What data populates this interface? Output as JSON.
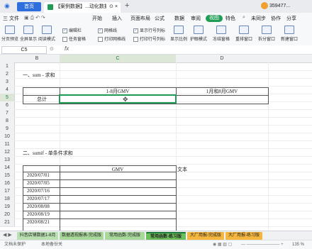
{
  "titlebar": {
    "home_tab": "首页",
    "doc_tab": "【案例数据】...动化数据报表",
    "pin": "⊙",
    "close": "×",
    "new_tab": "+",
    "user": "359477..."
  },
  "menu": {
    "file": "三 文件",
    "items": [
      "开始",
      "插入",
      "页面布局",
      "公式",
      "数据",
      "审阅",
      "视图",
      "特色",
      "未同步",
      "协作",
      "分享"
    ],
    "active": "视图"
  },
  "toolbar": {
    "buttons": [
      "分页预览",
      "全屏显示",
      "阅读模式",
      "显示比例",
      "护眼模式",
      "冻结窗格",
      "重排窗口",
      "拆分窗口",
      "新建窗口"
    ],
    "checkboxes": [
      {
        "label": "编辑栏",
        "checked": true
      },
      {
        "label": "网格线",
        "checked": true
      },
      {
        "label": "显示行号列标",
        "checked": true
      },
      {
        "label": "任务窗格",
        "checked": false
      },
      {
        "label": "打印网格线",
        "checked": false
      },
      {
        "label": "打印行号列标",
        "checked": false
      }
    ]
  },
  "formula": {
    "namebox": "C5",
    "zoom_icon": "⊙",
    "fx": "fx",
    "value": ""
  },
  "grid": {
    "columns": [
      "B",
      "C",
      "D"
    ],
    "selected_column": "C",
    "rows": [
      "1",
      "2",
      "3",
      "4",
      "5",
      "6",
      "7",
      "8",
      "9",
      "10",
      "11",
      "12",
      "13",
      "14",
      "15",
      "16",
      "17",
      "18",
      "19",
      "20",
      "21"
    ],
    "selected_row": "5",
    "section1_title": "一、sum - 求和",
    "header_c4": "1-8月GMV",
    "header_d4": "1月和8月GMV",
    "label_b5": "总计",
    "section2_title": "二、sumif - 单条件求和",
    "gmv_header": "GMV",
    "text_header": "文本",
    "dates": [
      "2020/07/01",
      "2020/07/05",
      "2020/07/16",
      "2020/07/17",
      "2020/08/08",
      "2020/08/19",
      "2020/08/21"
    ]
  },
  "sheets": [
    {
      "label": "抖音店铺数据1-8月",
      "color": "#b8e0b0"
    },
    {
      "label": "数据透视报表-完成版",
      "color": "#a8d89a"
    },
    {
      "label": "常用函数-完成版",
      "color": "#a8d89a"
    },
    {
      "label": "常用函数-练习版",
      "color": "#6cbf5a",
      "active": true
    },
    {
      "label": "大厂用报-完成版",
      "color": "#f4b63e"
    },
    {
      "label": "大厂用报-练习版",
      "color": "#f4b63e"
    }
  ],
  "status": {
    "protect": "文档未保护",
    "backup": "本地备份关",
    "zoom": "135 %"
  }
}
